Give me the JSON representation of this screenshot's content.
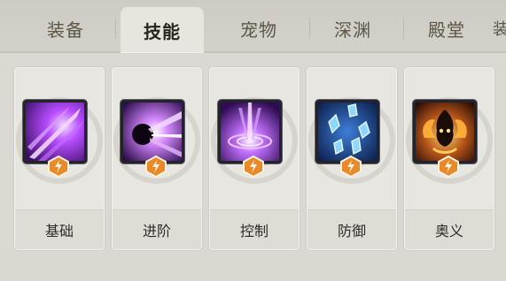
{
  "tabs": [
    {
      "label": "装备",
      "active": false
    },
    {
      "label": "技能",
      "active": true
    },
    {
      "label": "宠物",
      "active": false
    },
    {
      "label": "深渊",
      "active": false
    },
    {
      "label": "殿堂",
      "active": false
    }
  ],
  "skills": [
    {
      "label": "基础",
      "icon": "purple-slash-icon"
    },
    {
      "label": "进阶",
      "icon": "purple-vortex-icon"
    },
    {
      "label": "控制",
      "icon": "purple-burst-icon"
    },
    {
      "label": "防御",
      "icon": "blue-crystal-shield-icon"
    },
    {
      "label": "奥义",
      "icon": "golden-flame-spirit-icon"
    }
  ],
  "colors": {
    "badge": "#e98a2a",
    "active_tab": "#e7e5de"
  }
}
